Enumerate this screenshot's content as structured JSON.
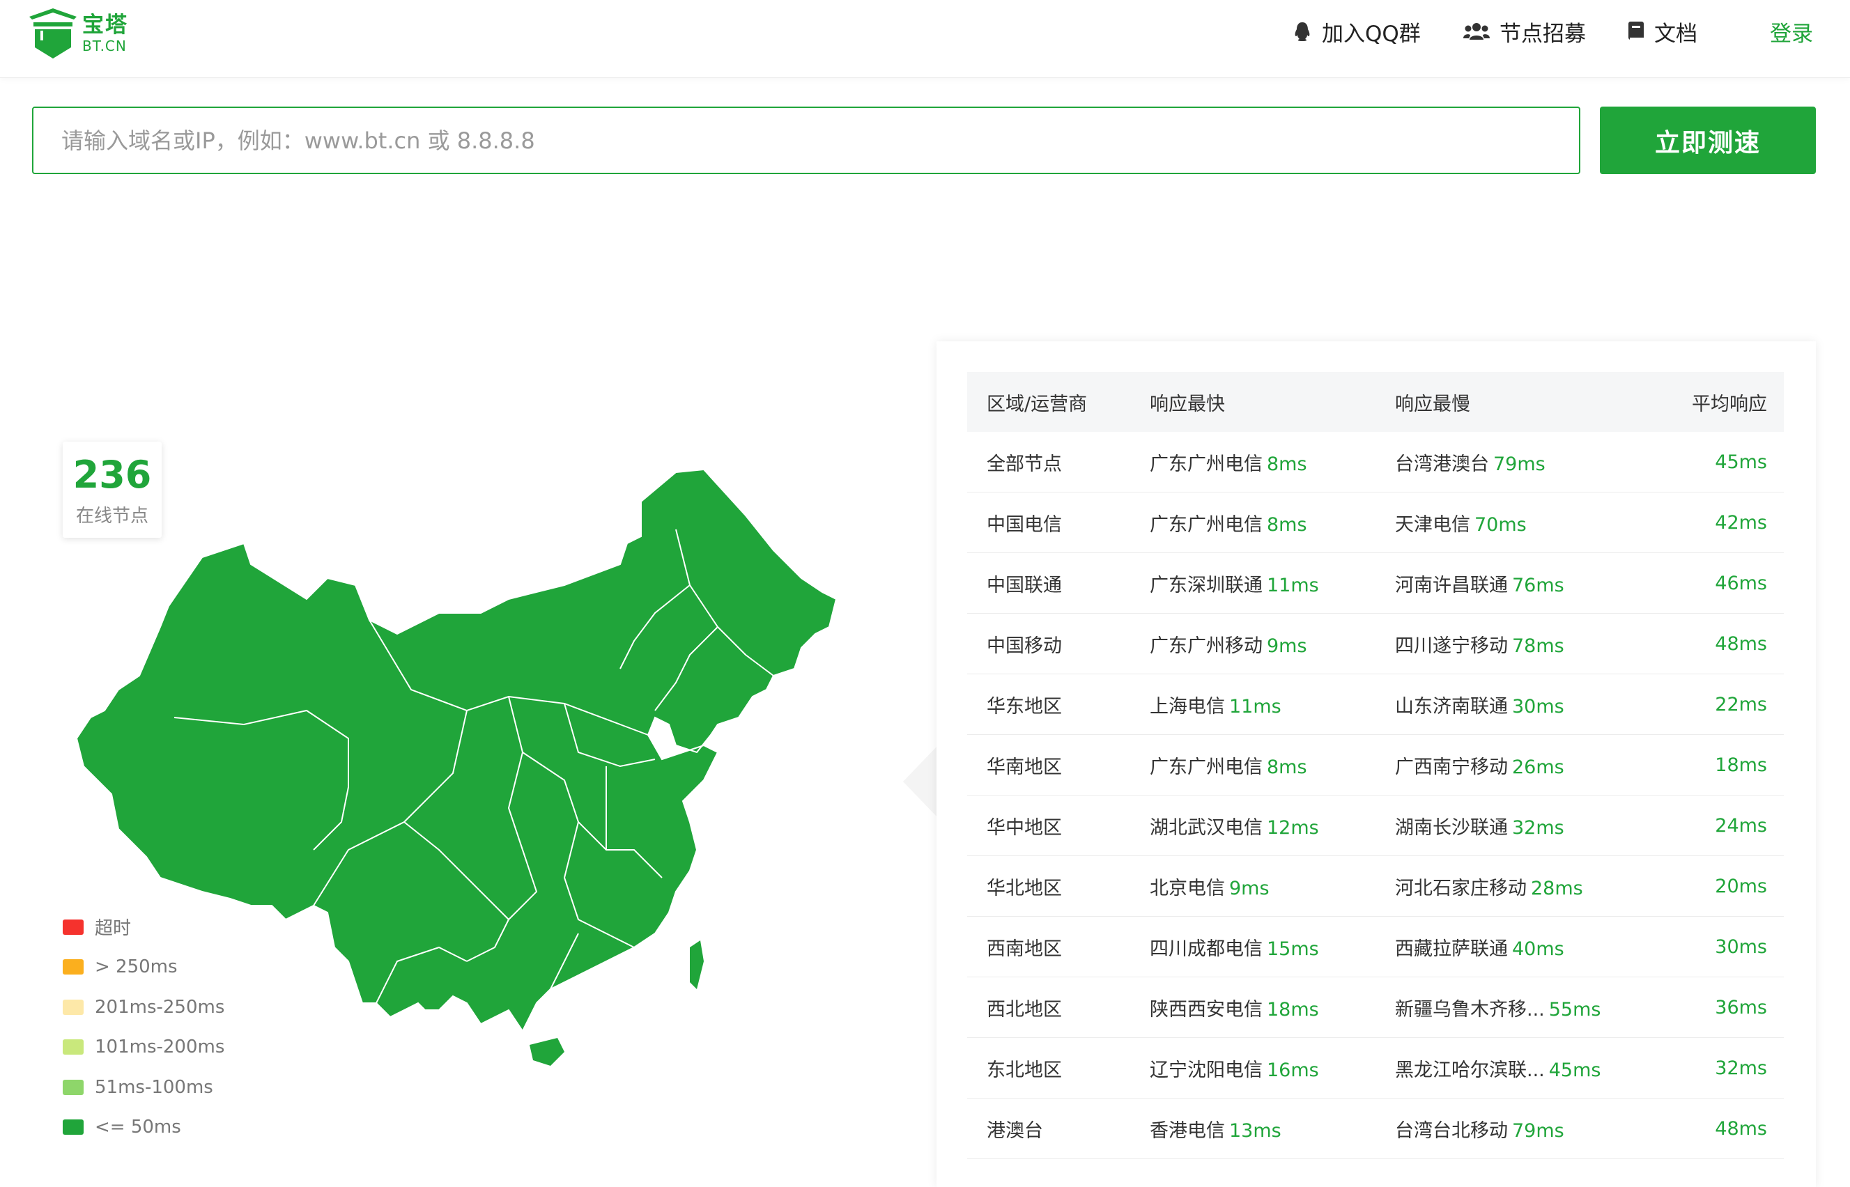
{
  "logo": {
    "name": "宝塔",
    "domain": "BT.CN"
  },
  "nav": {
    "qq_group": "加入QQ群",
    "node_recruit": "节点招募",
    "docs": "文档",
    "login": "登录"
  },
  "search": {
    "placeholder": "请输入域名或IP，例如：www.bt.cn 或 8.8.8.8",
    "button": "立即测速"
  },
  "online": {
    "count": "236",
    "label": "在线节点"
  },
  "legend": [
    {
      "label": "超时",
      "color": "#f5322d"
    },
    {
      "label": "> 250ms",
      "color": "#fbaf1e"
    },
    {
      "label": "201ms-250ms",
      "color": "#fde8a8"
    },
    {
      "label": "101ms-200ms",
      "color": "#c9e87c"
    },
    {
      "label": "51ms-100ms",
      "color": "#8ed66a"
    },
    {
      "label": "<= 50ms",
      "color": "#20a53a"
    }
  ],
  "table": {
    "headers": [
      "区域/运营商",
      "响应最快",
      "响应最慢",
      "平均响应"
    ],
    "rows": [
      {
        "region": "全部节点",
        "fastest": "广东广州电信",
        "fastest_ms": "8ms",
        "slowest": "台湾港澳台",
        "slowest_ms": "79ms",
        "average": "45ms"
      },
      {
        "region": "中国电信",
        "fastest": "广东广州电信",
        "fastest_ms": "8ms",
        "slowest": "天津电信",
        "slowest_ms": "70ms",
        "average": "42ms"
      },
      {
        "region": "中国联通",
        "fastest": "广东深圳联通",
        "fastest_ms": "11ms",
        "slowest": "河南许昌联通",
        "slowest_ms": "76ms",
        "average": "46ms"
      },
      {
        "region": "中国移动",
        "fastest": "广东广州移动",
        "fastest_ms": "9ms",
        "slowest": "四川遂宁移动",
        "slowest_ms": "78ms",
        "average": "48ms"
      },
      {
        "region": "华东地区",
        "fastest": "上海电信",
        "fastest_ms": "11ms",
        "slowest": "山东济南联通",
        "slowest_ms": "30ms",
        "average": "22ms"
      },
      {
        "region": "华南地区",
        "fastest": "广东广州电信",
        "fastest_ms": "8ms",
        "slowest": "广西南宁移动",
        "slowest_ms": "26ms",
        "average": "18ms"
      },
      {
        "region": "华中地区",
        "fastest": "湖北武汉电信",
        "fastest_ms": "12ms",
        "slowest": "湖南长沙联通",
        "slowest_ms": "32ms",
        "average": "24ms"
      },
      {
        "region": "华北地区",
        "fastest": "北京电信",
        "fastest_ms": "9ms",
        "slowest": "河北石家庄移动",
        "slowest_ms": "28ms",
        "average": "20ms"
      },
      {
        "region": "西南地区",
        "fastest": "四川成都电信",
        "fastest_ms": "15ms",
        "slowest": "西藏拉萨联通",
        "slowest_ms": "40ms",
        "average": "30ms"
      },
      {
        "region": "西北地区",
        "fastest": "陕西西安电信",
        "fastest_ms": "18ms",
        "slowest": "新疆乌鲁木齐移...",
        "slowest_ms": "55ms",
        "average": "36ms"
      },
      {
        "region": "东北地区",
        "fastest": "辽宁沈阳电信",
        "fastest_ms": "16ms",
        "slowest": "黑龙江哈尔滨联...",
        "slowest_ms": "45ms",
        "average": "32ms"
      },
      {
        "region": "港澳台",
        "fastest": "香港电信",
        "fastest_ms": "13ms",
        "slowest": "台湾台北移动",
        "slowest_ms": "79ms",
        "average": "48ms"
      }
    ]
  },
  "colors": {
    "accent": "#20a53a",
    "map_fill": "#20a53a"
  }
}
